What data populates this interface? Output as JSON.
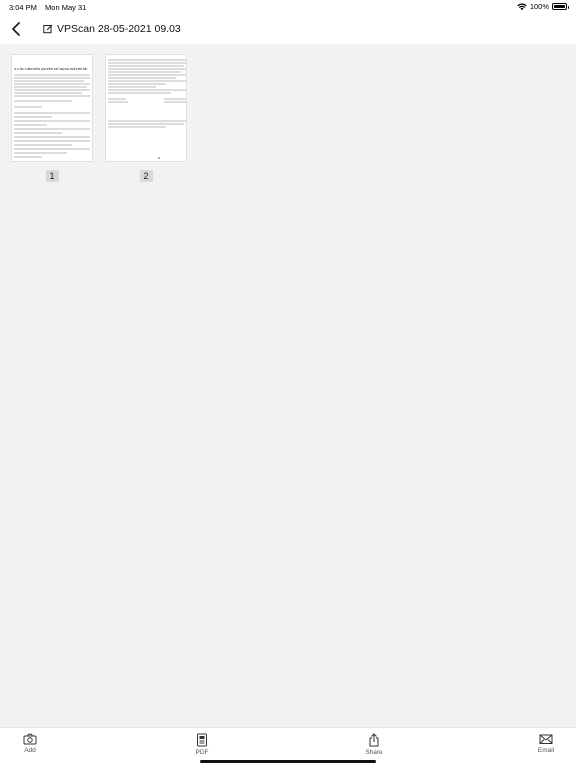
{
  "status": {
    "time": "3:04 PM",
    "date": "Mon May 31",
    "battery_pct": "100%",
    "battery_level": 1.0
  },
  "header": {
    "title": "VPScan 28-05-2021 09.03",
    "back_icon": "chevron-left-icon",
    "edit_icon": "edit-square-icon"
  },
  "pages": [
    {
      "number": "1",
      "thumb_heading": "Y CẦU CHUYỂN QUYỀN SỬ DỤNG ĐẤT BÌ NỀ"
    },
    {
      "number": "2",
      "thumb_heading": ""
    }
  ],
  "toolbar": {
    "add_label": "Add",
    "pdf_label": "PDF",
    "share_label": "Share",
    "email_label": "Email"
  },
  "colors": {
    "background": "#f2f2f2",
    "bar": "#ffffff",
    "icon": "#333333"
  }
}
